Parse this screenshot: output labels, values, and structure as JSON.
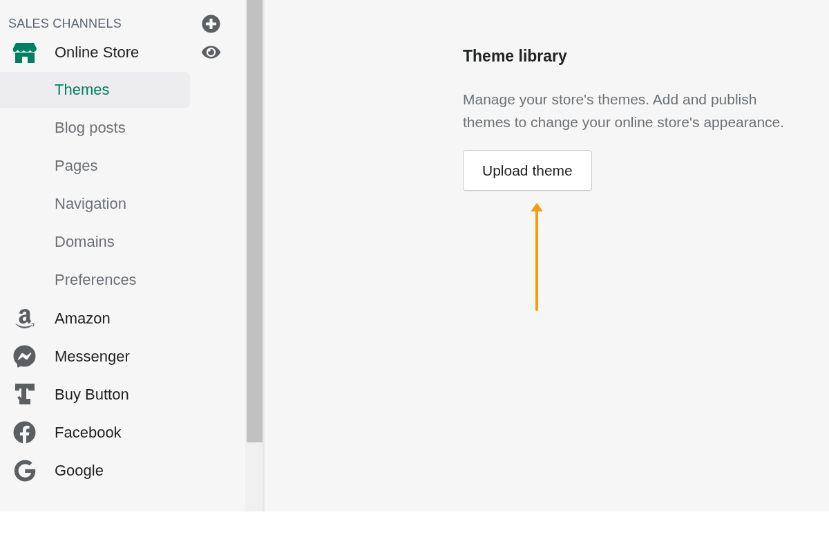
{
  "sidebar": {
    "heading": "SALES CHANNELS",
    "channels": [
      {
        "label": "Online Store",
        "children": [
          {
            "label": "Themes",
            "selected": true
          },
          {
            "label": "Blog posts",
            "selected": false
          },
          {
            "label": "Pages",
            "selected": false
          },
          {
            "label": "Navigation",
            "selected": false
          },
          {
            "label": "Domains",
            "selected": false
          },
          {
            "label": "Preferences",
            "selected": false
          }
        ]
      },
      {
        "label": "Amazon"
      },
      {
        "label": "Messenger"
      },
      {
        "label": "Buy Button"
      },
      {
        "label": "Facebook"
      },
      {
        "label": "Google"
      }
    ]
  },
  "main": {
    "title": "Theme library",
    "description": "Manage your store's themes. Add and publish themes to change your online store's appearance.",
    "button": "Upload theme"
  }
}
